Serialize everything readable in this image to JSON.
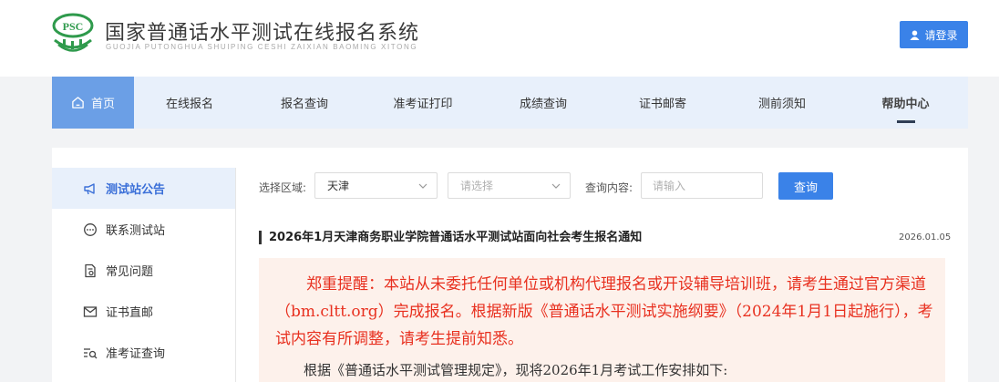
{
  "header": {
    "logo_text": "PSC",
    "title": "国家普通话水平测试在线报名系统",
    "subtitle": "GUOJIA PUTONGHUA SHUIPING CESHI ZAIXIAN BAOMING XITONG",
    "login_label": "请登录"
  },
  "nav": {
    "items": [
      {
        "label": "首页"
      },
      {
        "label": "在线报名"
      },
      {
        "label": "报名查询"
      },
      {
        "label": "准考证打印"
      },
      {
        "label": "成绩查询"
      },
      {
        "label": "证书邮寄"
      },
      {
        "label": "测前须知"
      },
      {
        "label": "帮助中心"
      }
    ]
  },
  "sidebar": {
    "items": [
      {
        "label": "测试站公告"
      },
      {
        "label": "联系测试站"
      },
      {
        "label": "常见问题"
      },
      {
        "label": "证书直邮"
      },
      {
        "label": "准考证查询"
      }
    ]
  },
  "filter": {
    "region_label": "选择区域:",
    "region_value": "天津",
    "station_placeholder": "请选择",
    "content_label": "查询内容:",
    "content_placeholder": "请输入",
    "query_label": "查询"
  },
  "article": {
    "title": "2026年1月天津商务职业学院普通话水平测试站面向社会考生报名通知",
    "date": "2026.01.05",
    "notice": "郑重提醒：本站从未委托任何单位或机构代理报名或开设辅导培训班，请考生通过官方渠道（bm.cltt.org）完成报名。根据新版《普通话水平测试实施纲要》（2024年1月1日起施行），考试内容有所调整，请考生提前知悉。",
    "body": "根据《普通话水平测试管理规定》，现将2026年1月考试工作安排如下:"
  },
  "colors": {
    "primary": "#3a82e8",
    "nav_bg": "#e8f0fb",
    "nav_active": "#6b9fe6",
    "warning_text": "#e8301f",
    "notice_bg": "#fdf1eb",
    "logo_green": "#2f9a4c"
  },
  "icons": {
    "logo": "psc-logo-icon",
    "login": "user-icon",
    "home": "home-icon",
    "sidebar": [
      "megaphone-icon",
      "chat-icon",
      "document-icon",
      "mail-icon",
      "search-list-icon"
    ],
    "chevron": "chevron-down-icon"
  }
}
